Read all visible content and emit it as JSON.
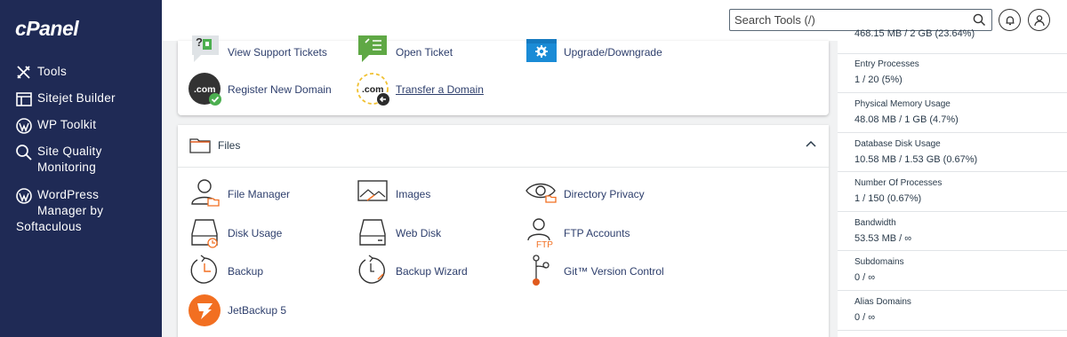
{
  "app": {
    "logo": "cPanel"
  },
  "sidebar": {
    "items": [
      {
        "label": "Tools",
        "icon": "tools-icon"
      },
      {
        "label": "Sitejet Builder",
        "icon": "sitejet-icon"
      },
      {
        "label": "WP Toolkit",
        "icon": "wordpress-icon"
      },
      {
        "label_line1": "Site Quality",
        "label_line2": "Monitoring",
        "icon": "search-icon"
      },
      {
        "label_line1": "WordPress",
        "label_line2": "Manager by",
        "label_line3": "Softaculous",
        "icon": "wordpress-icon"
      }
    ]
  },
  "topbar": {
    "search_placeholder": "Search Tools (/)"
  },
  "top_card": {
    "tools": [
      {
        "label": "View Support Tickets",
        "icon": "support-ticket-icon"
      },
      {
        "label": "Open Ticket",
        "icon": "open-ticket-icon"
      },
      {
        "label": "Upgrade/Downgrade",
        "icon": "upgrade-icon"
      },
      {
        "label": "Register New Domain",
        "icon": "register-domain-icon",
        "badge": ".com"
      },
      {
        "label": "Transfer a Domain",
        "icon": "transfer-domain-icon",
        "badge": ".com"
      }
    ]
  },
  "files_section": {
    "title": "Files",
    "tools": [
      {
        "label": "File Manager",
        "icon": "file-manager-icon"
      },
      {
        "label": "Images",
        "icon": "images-icon"
      },
      {
        "label": "Directory Privacy",
        "icon": "directory-privacy-icon"
      },
      {
        "label": "Disk Usage",
        "icon": "disk-usage-icon"
      },
      {
        "label": "Web Disk",
        "icon": "web-disk-icon"
      },
      {
        "label": "FTP Accounts",
        "icon": "ftp-accounts-icon",
        "badge": "FTP"
      },
      {
        "label": "Backup",
        "icon": "backup-icon"
      },
      {
        "label": "Backup Wizard",
        "icon": "backup-wizard-icon"
      },
      {
        "label": "Git™ Version Control",
        "icon": "git-icon"
      },
      {
        "label": "JetBackup 5",
        "icon": "jetbackup-icon"
      }
    ]
  },
  "stats": [
    {
      "label": "",
      "value": "468.15 MB / 2 GB   (23.64%)"
    },
    {
      "label": "Entry Processes",
      "value": "1 / 20   (5%)"
    },
    {
      "label": "Physical Memory Usage",
      "value": "48.08 MB / 1 GB   (4.7%)"
    },
    {
      "label": "Database Disk Usage",
      "value": "10.58 MB / 1.53 GB   (0.67%)"
    },
    {
      "label": "Number Of Processes",
      "value": "1 / 150   (0.67%)"
    },
    {
      "label": "Bandwidth",
      "value": "53.53 MB / ∞"
    },
    {
      "label": "Subdomains",
      "value": "0 / ∞"
    },
    {
      "label": "Alias Domains",
      "value": "0 / ∞"
    }
  ],
  "colors": {
    "sidebar_bg": "#1f2a55",
    "link": "#2d3e6c",
    "accent_orange": "#f26f21",
    "upgrade_blue": "#1a8bd6",
    "check_green": "#4caf50"
  }
}
